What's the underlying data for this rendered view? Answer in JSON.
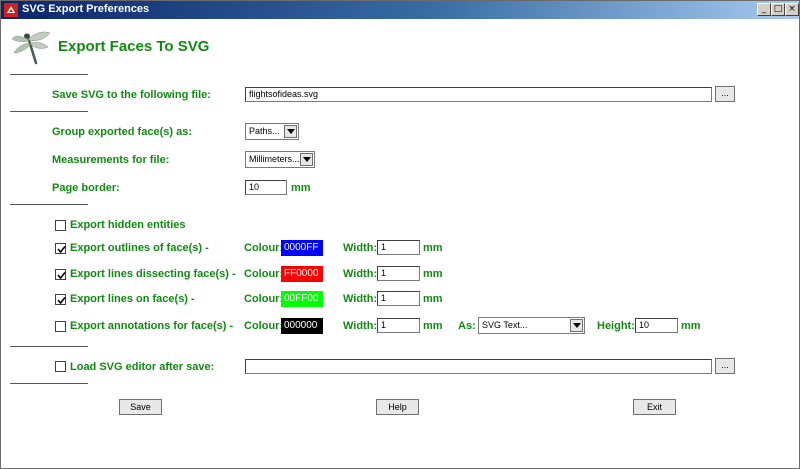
{
  "window": {
    "title": "SVG Export Preferences",
    "minimize": "_",
    "restore": "□",
    "close": "×"
  },
  "header": {
    "title": "Export Faces To SVG",
    "logo_icon": "dragonfly-icon"
  },
  "file": {
    "label": "Save SVG to the following file:",
    "value": "flightsofideas.svg",
    "browse": "..."
  },
  "group": {
    "label": "Group exported face(s) as:",
    "value": "Paths..."
  },
  "measure": {
    "label": "Measurements for file:",
    "value": "Millimeters..."
  },
  "border": {
    "label": "Page border:",
    "value": "10",
    "unit": "mm"
  },
  "hidden": {
    "label": "Export hidden entities",
    "checked": false
  },
  "common": {
    "colour_label": "Colour:",
    "width_label": "Width:",
    "unit": "mm"
  },
  "outlines": {
    "label": "Export outlines of face(s) -",
    "checked": true,
    "colour": "0000FF",
    "colour_bg": "#0000ff",
    "colour_fg": "#ffffff",
    "width": "1"
  },
  "dissect": {
    "label": "Export lines dissecting face(s) -",
    "checked": true,
    "colour": "FF0000",
    "colour_bg": "#ff0000",
    "colour_fg": "#ffffff",
    "width": "1"
  },
  "lines": {
    "label": "Export lines on face(s) -",
    "checked": true,
    "colour": "00FF00",
    "colour_bg": "#00ff00",
    "colour_fg": "#ffffff",
    "width": "1"
  },
  "annot": {
    "label": "Export annotations for face(s) -",
    "checked": false,
    "colour": "000000",
    "colour_bg": "#000000",
    "colour_fg": "#ffffff",
    "width": "1",
    "as_label": "As:",
    "as_value": "SVG Text...",
    "height_label": "Height:",
    "height_value": "10"
  },
  "editor": {
    "label": "Load SVG editor after save:",
    "value": "",
    "browse": "..."
  },
  "actions": {
    "save": "Save",
    "help": "Help",
    "exit": "Exit"
  },
  "colors": {
    "label_green": "#128a12"
  }
}
